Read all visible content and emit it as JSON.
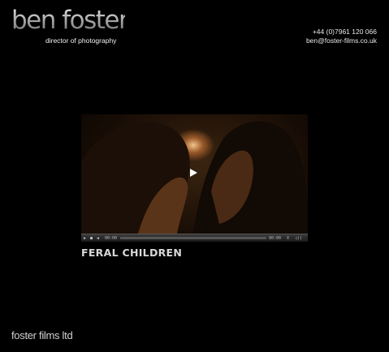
{
  "header": {
    "logo_text": "ben foster",
    "tagline": "director of photography",
    "phone": "+44 (0)7961 120 066",
    "email": "ben@foster-films.co.uk"
  },
  "player": {
    "current_time": "00:00",
    "total_time": "00:00",
    "progress": 0,
    "buttons": [
      "play-icon",
      "stop-icon",
      "rewind-icon",
      "fullscreen-icon",
      "volume-icon"
    ]
  },
  "video": {
    "title": "FERAL CHILDREN"
  },
  "footer": {
    "company": "foster films ltd"
  }
}
